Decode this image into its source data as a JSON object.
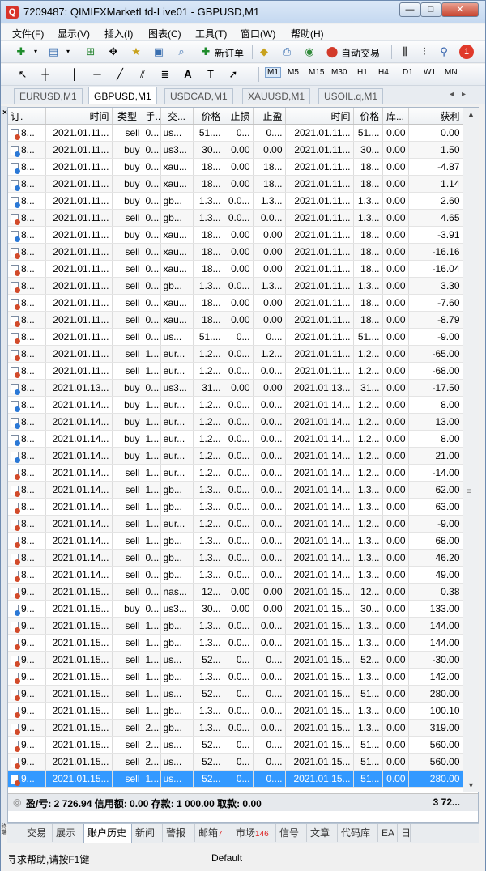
{
  "window": {
    "title": "7209487: QIMIFXMarketLtd-Live01 - GBPUSD,M1"
  },
  "menu": [
    "文件(F)",
    "显示(V)",
    "插入(I)",
    "图表(C)",
    "工具(T)",
    "窗口(W)",
    "帮助(H)"
  ],
  "toolbar": {
    "new_order": "新订单",
    "auto_trade": "自动交易",
    "notification_count": "1"
  },
  "timeframes": [
    "M1",
    "M5",
    "M15",
    "M30",
    "H1",
    "H4",
    "D1",
    "W1",
    "MN"
  ],
  "chart_tabs": [
    "EURUSD,M1",
    "GBPUSD,M1",
    "USDCAD,M1",
    "XAUUSD,M1",
    "USOIL.q,M1"
  ],
  "table": {
    "columns": [
      "订.",
      "时间",
      "类型",
      "手...",
      "交...",
      "价格",
      "止损",
      "止盈",
      "时间",
      "价格",
      "库...",
      "获利"
    ],
    "rows": [
      {
        "o": "8...",
        "t": "2021.01.11...",
        "type": "sell",
        "lot": "0...",
        "sym": "us...",
        "p": "51....",
        "sl": "0...",
        "tp": "0....",
        "t2": "2021.01.11...",
        "p2": "51....",
        "sw": "0.00",
        "pr": "0.00",
        "dot": "r"
      },
      {
        "o": "8...",
        "t": "2021.01.11...",
        "type": "buy",
        "lot": "0...",
        "sym": "us3...",
        "p": "30...",
        "sl": "0.00",
        "tp": "0.00",
        "t2": "2021.01.11...",
        "p2": "30...",
        "sw": "0.00",
        "pr": "1.50",
        "dot": "b"
      },
      {
        "o": "8...",
        "t": "2021.01.11...",
        "type": "buy",
        "lot": "0...",
        "sym": "xau...",
        "p": "18...",
        "sl": "0.00",
        "tp": "18...",
        "t2": "2021.01.11...",
        "p2": "18...",
        "sw": "0.00",
        "pr": "-4.87",
        "dot": "b"
      },
      {
        "o": "8...",
        "t": "2021.01.11...",
        "type": "buy",
        "lot": "0...",
        "sym": "xau...",
        "p": "18...",
        "sl": "0.00",
        "tp": "18...",
        "t2": "2021.01.11...",
        "p2": "18...",
        "sw": "0.00",
        "pr": "1.14",
        "dot": "b"
      },
      {
        "o": "8...",
        "t": "2021.01.11...",
        "type": "buy",
        "lot": "0...",
        "sym": "gb...",
        "p": "1.3...",
        "sl": "0.0...",
        "tp": "1.3...",
        "t2": "2021.01.11...",
        "p2": "1.3...",
        "sw": "0.00",
        "pr": "2.60",
        "dot": "b"
      },
      {
        "o": "8...",
        "t": "2021.01.11...",
        "type": "sell",
        "lot": "0...",
        "sym": "gb...",
        "p": "1.3...",
        "sl": "0.0...",
        "tp": "0.0...",
        "t2": "2021.01.11...",
        "p2": "1.3...",
        "sw": "0.00",
        "pr": "4.65",
        "dot": "r"
      },
      {
        "o": "8...",
        "t": "2021.01.11...",
        "type": "buy",
        "lot": "0...",
        "sym": "xau...",
        "p": "18...",
        "sl": "0.00",
        "tp": "0.00",
        "t2": "2021.01.11...",
        "p2": "18...",
        "sw": "0.00",
        "pr": "-3.91",
        "dot": "b"
      },
      {
        "o": "8...",
        "t": "2021.01.11...",
        "type": "sell",
        "lot": "0...",
        "sym": "xau...",
        "p": "18...",
        "sl": "0.00",
        "tp": "0.00",
        "t2": "2021.01.11...",
        "p2": "18...",
        "sw": "0.00",
        "pr": "-16.16",
        "dot": "r"
      },
      {
        "o": "8...",
        "t": "2021.01.11...",
        "type": "sell",
        "lot": "0...",
        "sym": "xau...",
        "p": "18...",
        "sl": "0.00",
        "tp": "0.00",
        "t2": "2021.01.11...",
        "p2": "18...",
        "sw": "0.00",
        "pr": "-16.04",
        "dot": "r"
      },
      {
        "o": "8...",
        "t": "2021.01.11...",
        "type": "sell",
        "lot": "0...",
        "sym": "gb...",
        "p": "1.3...",
        "sl": "0.0...",
        "tp": "1.3...",
        "t2": "2021.01.11...",
        "p2": "1.3...",
        "sw": "0.00",
        "pr": "3.30",
        "dot": "r"
      },
      {
        "o": "8...",
        "t": "2021.01.11...",
        "type": "sell",
        "lot": "0...",
        "sym": "xau...",
        "p": "18...",
        "sl": "0.00",
        "tp": "0.00",
        "t2": "2021.01.11...",
        "p2": "18...",
        "sw": "0.00",
        "pr": "-7.60",
        "dot": "r"
      },
      {
        "o": "8...",
        "t": "2021.01.11...",
        "type": "sell",
        "lot": "0...",
        "sym": "xau...",
        "p": "18...",
        "sl": "0.00",
        "tp": "0.00",
        "t2": "2021.01.11...",
        "p2": "18...",
        "sw": "0.00",
        "pr": "-8.79",
        "dot": "r"
      },
      {
        "o": "8...",
        "t": "2021.01.11...",
        "type": "sell",
        "lot": "0...",
        "sym": "us...",
        "p": "51....",
        "sl": "0...",
        "tp": "0....",
        "t2": "2021.01.11...",
        "p2": "51....",
        "sw": "0.00",
        "pr": "-9.00",
        "dot": "r"
      },
      {
        "o": "8...",
        "t": "2021.01.11...",
        "type": "sell",
        "lot": "1...",
        "sym": "eur...",
        "p": "1.2...",
        "sl": "0.0...",
        "tp": "1.2...",
        "t2": "2021.01.11...",
        "p2": "1.2...",
        "sw": "0.00",
        "pr": "-65.00",
        "dot": "r"
      },
      {
        "o": "8...",
        "t": "2021.01.11...",
        "type": "sell",
        "lot": "1...",
        "sym": "eur...",
        "p": "1.2...",
        "sl": "0.0...",
        "tp": "0.0...",
        "t2": "2021.01.11...",
        "p2": "1.2...",
        "sw": "0.00",
        "pr": "-68.00",
        "dot": "r"
      },
      {
        "o": "8...",
        "t": "2021.01.13...",
        "type": "buy",
        "lot": "0...",
        "sym": "us3...",
        "p": "31...",
        "sl": "0.00",
        "tp": "0.00",
        "t2": "2021.01.13...",
        "p2": "31...",
        "sw": "0.00",
        "pr": "-17.50",
        "dot": "b"
      },
      {
        "o": "8...",
        "t": "2021.01.14...",
        "type": "buy",
        "lot": "1...",
        "sym": "eur...",
        "p": "1.2...",
        "sl": "0.0...",
        "tp": "0.0...",
        "t2": "2021.01.14...",
        "p2": "1.2...",
        "sw": "0.00",
        "pr": "8.00",
        "dot": "b"
      },
      {
        "o": "8...",
        "t": "2021.01.14...",
        "type": "buy",
        "lot": "1...",
        "sym": "eur...",
        "p": "1.2...",
        "sl": "0.0...",
        "tp": "0.0...",
        "t2": "2021.01.14...",
        "p2": "1.2...",
        "sw": "0.00",
        "pr": "13.00",
        "dot": "b"
      },
      {
        "o": "8...",
        "t": "2021.01.14...",
        "type": "buy",
        "lot": "1...",
        "sym": "eur...",
        "p": "1.2...",
        "sl": "0.0...",
        "tp": "0.0...",
        "t2": "2021.01.14...",
        "p2": "1.2...",
        "sw": "0.00",
        "pr": "8.00",
        "dot": "b"
      },
      {
        "o": "8...",
        "t": "2021.01.14...",
        "type": "buy",
        "lot": "1...",
        "sym": "eur...",
        "p": "1.2...",
        "sl": "0.0...",
        "tp": "0.0...",
        "t2": "2021.01.14...",
        "p2": "1.2...",
        "sw": "0.00",
        "pr": "21.00",
        "dot": "b"
      },
      {
        "o": "8...",
        "t": "2021.01.14...",
        "type": "sell",
        "lot": "1...",
        "sym": "eur...",
        "p": "1.2...",
        "sl": "0.0...",
        "tp": "0.0...",
        "t2": "2021.01.14...",
        "p2": "1.2...",
        "sw": "0.00",
        "pr": "-14.00",
        "dot": "r"
      },
      {
        "o": "8...",
        "t": "2021.01.14...",
        "type": "sell",
        "lot": "1...",
        "sym": "gb...",
        "p": "1.3...",
        "sl": "0.0...",
        "tp": "0.0...",
        "t2": "2021.01.14...",
        "p2": "1.3...",
        "sw": "0.00",
        "pr": "62.00",
        "dot": "r"
      },
      {
        "o": "8...",
        "t": "2021.01.14...",
        "type": "sell",
        "lot": "1...",
        "sym": "gb...",
        "p": "1.3...",
        "sl": "0.0...",
        "tp": "0.0...",
        "t2": "2021.01.14...",
        "p2": "1.3...",
        "sw": "0.00",
        "pr": "63.00",
        "dot": "r"
      },
      {
        "o": "8...",
        "t": "2021.01.14...",
        "type": "sell",
        "lot": "1...",
        "sym": "eur...",
        "p": "1.2...",
        "sl": "0.0...",
        "tp": "0.0...",
        "t2": "2021.01.14...",
        "p2": "1.2...",
        "sw": "0.00",
        "pr": "-9.00",
        "dot": "r"
      },
      {
        "o": "8...",
        "t": "2021.01.14...",
        "type": "sell",
        "lot": "1...",
        "sym": "gb...",
        "p": "1.3...",
        "sl": "0.0...",
        "tp": "0.0...",
        "t2": "2021.01.14...",
        "p2": "1.3...",
        "sw": "0.00",
        "pr": "68.00",
        "dot": "r"
      },
      {
        "o": "8...",
        "t": "2021.01.14...",
        "type": "sell",
        "lot": "0...",
        "sym": "gb...",
        "p": "1.3...",
        "sl": "0.0...",
        "tp": "0.0...",
        "t2": "2021.01.14...",
        "p2": "1.3...",
        "sw": "0.00",
        "pr": "46.20",
        "dot": "r"
      },
      {
        "o": "8...",
        "t": "2021.01.14...",
        "type": "sell",
        "lot": "0...",
        "sym": "gb...",
        "p": "1.3...",
        "sl": "0.0...",
        "tp": "0.0...",
        "t2": "2021.01.14...",
        "p2": "1.3...",
        "sw": "0.00",
        "pr": "49.00",
        "dot": "r"
      },
      {
        "o": "9...",
        "t": "2021.01.15...",
        "type": "sell",
        "lot": "0...",
        "sym": "nas...",
        "p": "12...",
        "sl": "0.00",
        "tp": "0.00",
        "t2": "2021.01.15...",
        "p2": "12...",
        "sw": "0.00",
        "pr": "0.38",
        "dot": "r"
      },
      {
        "o": "9...",
        "t": "2021.01.15...",
        "type": "buy",
        "lot": "0...",
        "sym": "us3...",
        "p": "30...",
        "sl": "0.00",
        "tp": "0.00",
        "t2": "2021.01.15...",
        "p2": "30...",
        "sw": "0.00",
        "pr": "133.00",
        "dot": "b"
      },
      {
        "o": "9...",
        "t": "2021.01.15...",
        "type": "sell",
        "lot": "1...",
        "sym": "gb...",
        "p": "1.3...",
        "sl": "0.0...",
        "tp": "0.0...",
        "t2": "2021.01.15...",
        "p2": "1.3...",
        "sw": "0.00",
        "pr": "144.00",
        "dot": "r"
      },
      {
        "o": "9...",
        "t": "2021.01.15...",
        "type": "sell",
        "lot": "1...",
        "sym": "gb...",
        "p": "1.3...",
        "sl": "0.0...",
        "tp": "0.0...",
        "t2": "2021.01.15...",
        "p2": "1.3...",
        "sw": "0.00",
        "pr": "144.00",
        "dot": "r"
      },
      {
        "o": "9...",
        "t": "2021.01.15...",
        "type": "sell",
        "lot": "1...",
        "sym": "us...",
        "p": "52...",
        "sl": "0...",
        "tp": "0....",
        "t2": "2021.01.15...",
        "p2": "52...",
        "sw": "0.00",
        "pr": "-30.00",
        "dot": "r"
      },
      {
        "o": "9...",
        "t": "2021.01.15...",
        "type": "sell",
        "lot": "1...",
        "sym": "gb...",
        "p": "1.3...",
        "sl": "0.0...",
        "tp": "0.0...",
        "t2": "2021.01.15...",
        "p2": "1.3...",
        "sw": "0.00",
        "pr": "142.00",
        "dot": "r"
      },
      {
        "o": "9...",
        "t": "2021.01.15...",
        "type": "sell",
        "lot": "1...",
        "sym": "us...",
        "p": "52...",
        "sl": "0...",
        "tp": "0....",
        "t2": "2021.01.15...",
        "p2": "51...",
        "sw": "0.00",
        "pr": "280.00",
        "dot": "r"
      },
      {
        "o": "9...",
        "t": "2021.01.15...",
        "type": "sell",
        "lot": "1...",
        "sym": "gb...",
        "p": "1.3...",
        "sl": "0.0...",
        "tp": "0.0...",
        "t2": "2021.01.15...",
        "p2": "1.3...",
        "sw": "0.00",
        "pr": "100.10",
        "dot": "r"
      },
      {
        "o": "9...",
        "t": "2021.01.15...",
        "type": "sell",
        "lot": "2...",
        "sym": "gb...",
        "p": "1.3...",
        "sl": "0.0...",
        "tp": "0.0...",
        "t2": "2021.01.15...",
        "p2": "1.3...",
        "sw": "0.00",
        "pr": "319.00",
        "dot": "r"
      },
      {
        "o": "9...",
        "t": "2021.01.15...",
        "type": "sell",
        "lot": "2...",
        "sym": "us...",
        "p": "52...",
        "sl": "0...",
        "tp": "0....",
        "t2": "2021.01.15...",
        "p2": "51...",
        "sw": "0.00",
        "pr": "560.00",
        "dot": "r"
      },
      {
        "o": "9...",
        "t": "2021.01.15...",
        "type": "sell",
        "lot": "2...",
        "sym": "us...",
        "p": "52...",
        "sl": "0...",
        "tp": "0....",
        "t2": "2021.01.15...",
        "p2": "51...",
        "sw": "0.00",
        "pr": "560.00",
        "dot": "r"
      },
      {
        "o": "9...",
        "t": "2021.01.15...",
        "type": "sell",
        "lot": "1...",
        "sym": "us...",
        "p": "52...",
        "sl": "0...",
        "tp": "0....",
        "t2": "2021.01.15...",
        "p2": "51...",
        "sw": "0.00",
        "pr": "280.00",
        "dot": "r",
        "selected": true
      }
    ]
  },
  "summary": {
    "text": "盈/亏: 2 726.94  信用额: 0.00  存款: 1 000.00  取款: 0.00",
    "total": "3 72..."
  },
  "bottom_tabs": [
    {
      "label": "交易",
      "count": ""
    },
    {
      "label": "展示",
      "count": ""
    },
    {
      "label": "账户历史",
      "count": ""
    },
    {
      "label": "新闻",
      "count": ""
    },
    {
      "label": "警报",
      "count": ""
    },
    {
      "label": "邮箱",
      "count": "7"
    },
    {
      "label": "市场",
      "count": "146"
    },
    {
      "label": "信号",
      "count": ""
    },
    {
      "label": "文章",
      "count": ""
    },
    {
      "label": "代码库",
      "count": ""
    },
    {
      "label": "EA",
      "count": ""
    },
    {
      "label": "日",
      "count": ""
    }
  ],
  "active_bottom_tab": "账户历史",
  "vertical_title": "终端",
  "status": {
    "help": "寻求帮助,请按F1键",
    "profile": "Default"
  },
  "colors": {
    "selected_row": "#3399ff",
    "buy_dot": "#2a78d6",
    "sell_dot": "#d24a2a"
  }
}
